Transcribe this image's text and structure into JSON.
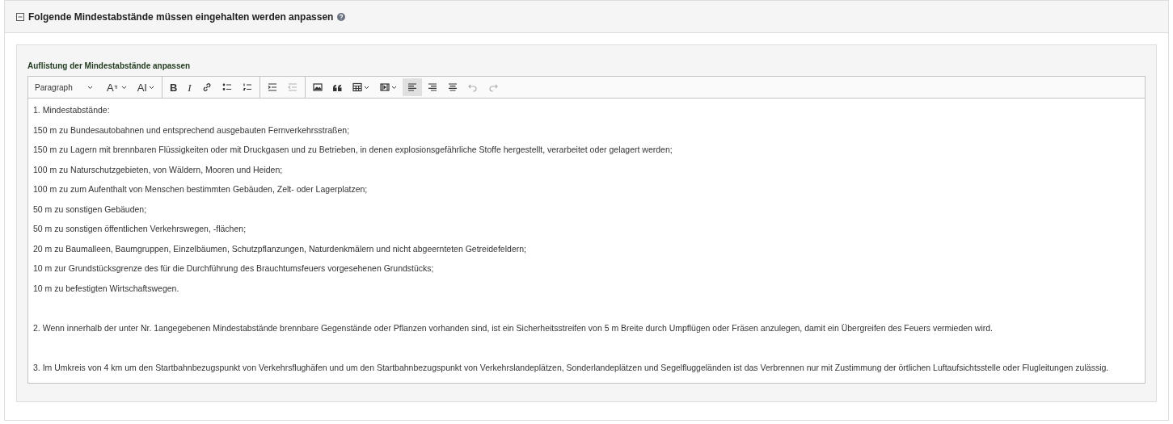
{
  "panel": {
    "title": "Folgende Mindestabstände müssen eingehalten werden anpassen",
    "expanded": true
  },
  "editor": {
    "label": "Auflistung der Mindestabstände anpassen",
    "heading_select": "Paragraph",
    "toolbar": [
      [
        {
          "kind": "font-size",
          "glyph": "A",
          "selected": false,
          "disabled": false
        },
        {
          "kind": "font-family",
          "glyph": "AI",
          "selected": false,
          "disabled": false
        }
      ],
      [
        {
          "kind": "bold",
          "glyph": "B",
          "selected": false,
          "disabled": false
        },
        {
          "kind": "italic",
          "glyph": "I",
          "selected": false,
          "disabled": false
        },
        {
          "kind": "link",
          "selected": false,
          "disabled": false
        },
        {
          "kind": "bullet-list",
          "selected": false,
          "disabled": false
        },
        {
          "kind": "numbered-list",
          "selected": false,
          "disabled": false
        }
      ],
      [
        {
          "kind": "indent",
          "selected": false,
          "disabled": false
        },
        {
          "kind": "outdent",
          "selected": false,
          "disabled": true
        }
      ],
      [
        {
          "kind": "image",
          "selected": false,
          "disabled": false
        },
        {
          "kind": "quote",
          "selected": false,
          "disabled": false
        },
        {
          "kind": "table",
          "selected": false,
          "disabled": false
        },
        {
          "kind": "media",
          "selected": false,
          "disabled": false
        },
        {
          "kind": "align-left",
          "selected": true,
          "disabled": false
        },
        {
          "kind": "align-right",
          "selected": false,
          "disabled": false
        },
        {
          "kind": "align-center",
          "selected": false,
          "disabled": false
        },
        {
          "kind": "undo",
          "selected": false,
          "disabled": true
        },
        {
          "kind": "redo",
          "selected": false,
          "disabled": true
        }
      ]
    ],
    "paragraphs": [
      {
        "text": "1. Mindestabstände:",
        "spaced": false
      },
      {
        "text": "150 m zu Bundesautobahnen und entsprechend ausgebauten Fernverkehrsstraßen;",
        "spaced": false
      },
      {
        "text": "150 m zu Lagern mit brennbaren Flüssigkeiten oder mit Druckgasen und zu Betrieben, in denen explosionsgefährliche Stoffe hergestellt, verarbeitet oder gelagert werden;",
        "spaced": false
      },
      {
        "text": "100 m zu Naturschutzgebieten, von Wäldern, Mooren und Heiden;",
        "spaced": false
      },
      {
        "text": "100 m zu zum Aufenthalt von Menschen bestimmten Gebäuden, Zelt- oder Lagerplatzen;",
        "spaced": false
      },
      {
        "text": "50 m zu sonstigen Gebäuden;",
        "spaced": false
      },
      {
        "text": "50 m zu sonstigen öffentlichen Verkehrswegen, -flächen;",
        "spaced": false
      },
      {
        "text": "20 m zu Baumalleen, Baumgruppen, Einzelbäumen, Schutzpflanzungen, Naturdenkmälern und nicht abgeernteten Getreidefeldern;",
        "spaced": false
      },
      {
        "text": "10 m zur Grundstücksgrenze des für die Durchführung des Brauchtumsfeuers vorgesehenen Grundstücks;",
        "spaced": false
      },
      {
        "text": "10 m zu befestigten Wirtschaftswegen.",
        "spaced": false
      },
      {
        "text": "2. Wenn innerhalb der unter Nr. 1angegebenen Mindestabstände brennbare Gegenstände oder Pflanzen vorhanden sind, ist ein Sicherheitsstreifen von 5 m Breite durch Umpflügen oder Fräsen anzulegen, damit ein Übergreifen des Feuers vermieden wird.",
        "spaced": true
      },
      {
        "text": "3. Im Umkreis von 4 km um den Startbahnbezugspunkt von Verkehrsflughäfen und um den Startbahnbezugspunkt von Verkehrslandeplätzen, Sonderlandeplätzen und Segelfluggeländen ist das Verbrennen nur mit Zustimmung der örtlichen Luftaufsichtsstelle oder Flugleitungen zulässig.",
        "spaced": true
      }
    ]
  }
}
